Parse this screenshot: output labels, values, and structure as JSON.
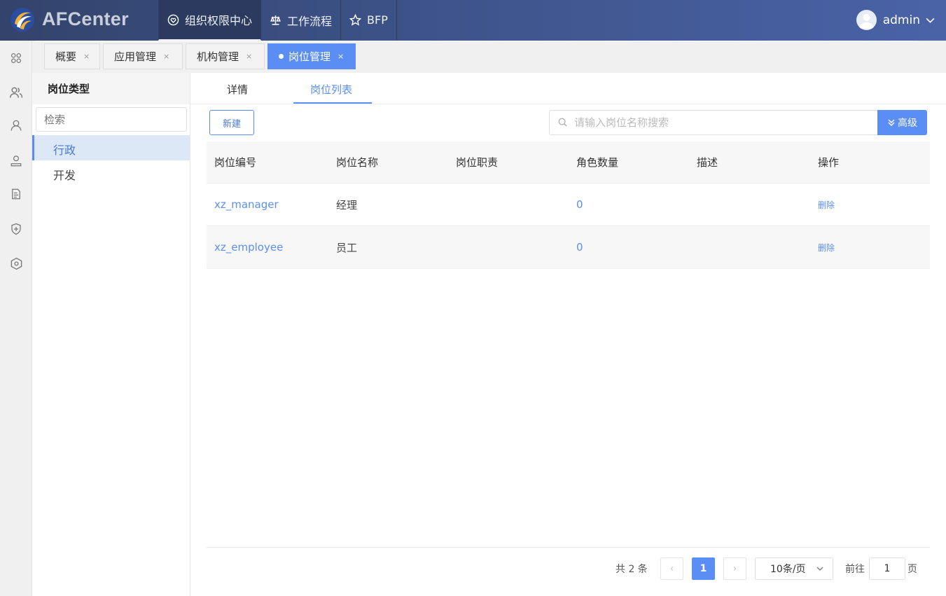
{
  "app": {
    "brand": "AFCenter",
    "user": "admin"
  },
  "topnav": [
    {
      "label": "组织权限中心",
      "icon": "heart-shield-icon",
      "active": true
    },
    {
      "label": "工作流程",
      "icon": "scale-icon",
      "active": false
    },
    {
      "label": "BFP",
      "icon": "star-icon",
      "active": false
    }
  ],
  "rail": [
    "apps-icon",
    "users-group-icon",
    "user-icon",
    "user-badge-icon",
    "document-list-icon",
    "shield-plus-icon",
    "hexagon-settings-icon"
  ],
  "tabs": [
    {
      "label": "概要",
      "close": "×",
      "active": false
    },
    {
      "label": "应用管理",
      "close": "×",
      "active": false
    },
    {
      "label": "机构管理",
      "close": "×",
      "active": false
    },
    {
      "label": "岗位管理",
      "close": "×",
      "active": true
    }
  ],
  "side": {
    "title": "岗位类型",
    "search_placeholder": "检索",
    "items": [
      {
        "label": "行政",
        "selected": true
      },
      {
        "label": "开发",
        "selected": false
      }
    ]
  },
  "subtabs": [
    {
      "label": "详情",
      "active": false
    },
    {
      "label": "岗位列表",
      "active": true
    }
  ],
  "toolbar": {
    "new_label": "新建",
    "search_placeholder": "请输入岗位名称搜索",
    "advanced_label": "高级"
  },
  "table": {
    "columns": [
      "岗位编号",
      "岗位名称",
      "岗位职责",
      "角色数量",
      "描述",
      "操作"
    ],
    "rows": [
      {
        "code": "xz_manager",
        "name": "经理",
        "duty": "",
        "roles": "0",
        "desc": "",
        "action": "删除"
      },
      {
        "code": "xz_employee",
        "name": "员工",
        "duty": "",
        "roles": "0",
        "desc": "",
        "action": "删除"
      }
    ]
  },
  "pager": {
    "total": "共 2 条",
    "prev": "‹",
    "current": "1",
    "next": "›",
    "page_size": "10条/页",
    "goto_label": "前往",
    "goto_value": "1",
    "goto_unit": "页"
  },
  "colors": {
    "primary": "#5b8ef5",
    "header": "#3d5389"
  }
}
